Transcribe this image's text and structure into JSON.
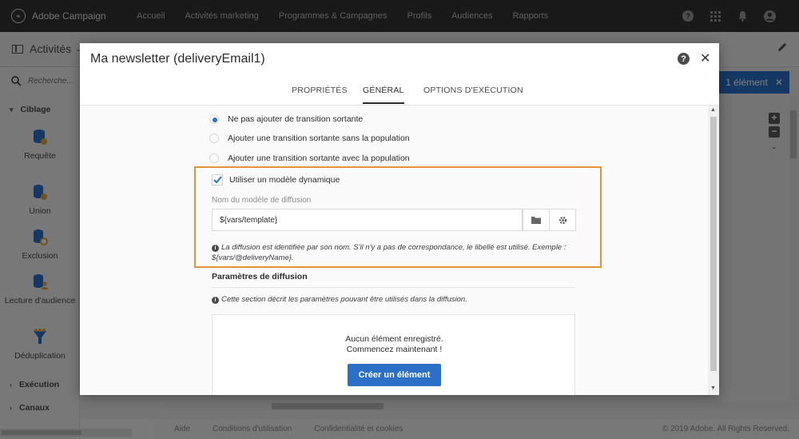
{
  "app": {
    "name": "Adobe Campaign",
    "nav": [
      "Accueil",
      "Activités marketing",
      "Programmes & Campagnes",
      "Profils",
      "Audiences",
      "Rapports"
    ]
  },
  "background": {
    "page_title": "Activités",
    "search_placeholder": "Recherche...",
    "sections": {
      "targeting": "Ciblage",
      "execution": "Exécution",
      "channels": "Canaux"
    },
    "activities": [
      "Requête",
      "Union",
      "Exclusion",
      "Lecture d'audience",
      "Déduplication"
    ],
    "selection_badge": "1 élément",
    "footer": {
      "links": [
        "Aide",
        "Conditions d'utilisation",
        "Confidentialité et cookies"
      ],
      "copyright": "© 2019 Adobe. All Rights Reserved."
    }
  },
  "modal": {
    "title": "Ma newsletter (deliveryEmail1)",
    "tabs": [
      "PROPRIÉTÉS",
      "GÉNÉRAL",
      "OPTIONS D'EXÉCUTION"
    ],
    "active_tab": "GÉNÉRAL",
    "radios": [
      {
        "label": "Ne pas ajouter de transition sortante",
        "selected": true
      },
      {
        "label": "Ajouter une transition sortante sans la population",
        "selected": false
      },
      {
        "label": "Ajouter une transition sortante avec la population",
        "selected": false
      }
    ],
    "dynamic_template": {
      "checkbox_label": "Utiliser un modèle dynamique",
      "checked": true,
      "field_label": "Nom du modèle de diffusion",
      "field_value": "${vars/template}",
      "info": "La diffusion est identifiée par son nom. S'il n'y a pas de correspondance, le libellé est utilisé. Exemple : ${vars/@deliveryName}."
    },
    "delivery_params": {
      "title": "Paramètres de diffusion",
      "info": "Cette section décrit les paramètres pouvant être utilisés dans la diffusion.",
      "empty_line1": "Aucun élément enregistré.",
      "empty_line2": "Commencez maintenant !",
      "create_button": "Créer un élément"
    }
  },
  "colors": {
    "accent": "#2b6fc7",
    "highlight": "#e8913d",
    "topbar": "#323232"
  }
}
